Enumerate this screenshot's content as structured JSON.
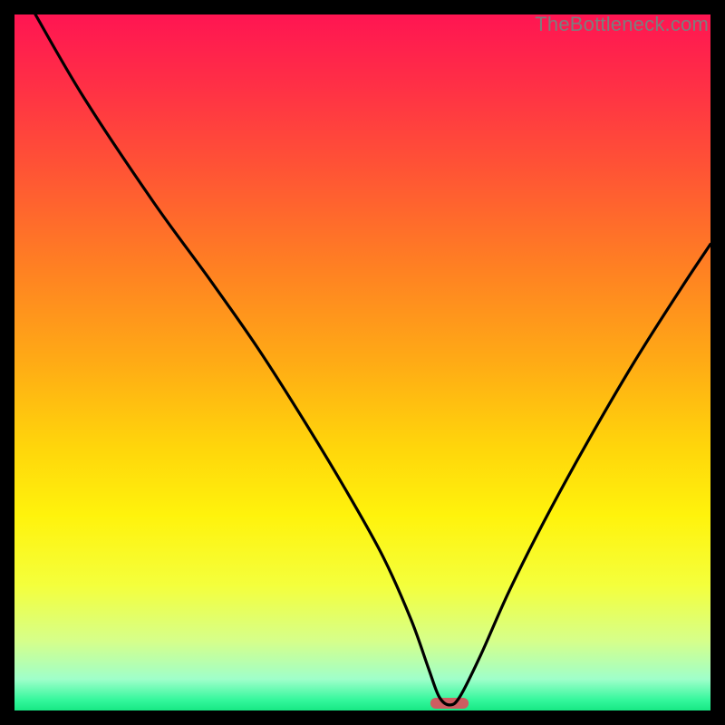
{
  "watermark": "TheBottleneck.com",
  "chart_data": {
    "type": "line",
    "title": "",
    "xlabel": "",
    "ylabel": "",
    "xlim": [
      0,
      100
    ],
    "ylim": [
      0,
      100
    ],
    "grid": false,
    "legend": false,
    "series": [
      {
        "name": "bottleneck-curve",
        "x": [
          3,
          10,
          20,
          28,
          35,
          42,
          48,
          53,
          57,
          59.5,
          61,
          62.5,
          64,
          67,
          71,
          76,
          82,
          89,
          96,
          100
        ],
        "y": [
          100,
          88,
          73,
          62,
          52,
          41,
          31,
          22,
          13,
          6,
          2,
          0.8,
          2,
          8,
          17,
          27,
          38,
          50,
          61,
          67
        ]
      }
    ],
    "marker": {
      "name": "optimal-marker",
      "x": 62.5,
      "width": 5.5,
      "color": "#cd5d61"
    },
    "gradient_stops": [
      {
        "offset": 0.0,
        "color": "#ff1552"
      },
      {
        "offset": 0.1,
        "color": "#ff2f46"
      },
      {
        "offset": 0.22,
        "color": "#ff5335"
      },
      {
        "offset": 0.36,
        "color": "#ff7f23"
      },
      {
        "offset": 0.5,
        "color": "#ffab15"
      },
      {
        "offset": 0.62,
        "color": "#ffd50b"
      },
      {
        "offset": 0.72,
        "color": "#fff30c"
      },
      {
        "offset": 0.82,
        "color": "#f4ff3c"
      },
      {
        "offset": 0.9,
        "color": "#d6ff8a"
      },
      {
        "offset": 0.955,
        "color": "#9fffca"
      },
      {
        "offset": 0.985,
        "color": "#34f79c"
      },
      {
        "offset": 1.0,
        "color": "#17e884"
      }
    ]
  }
}
